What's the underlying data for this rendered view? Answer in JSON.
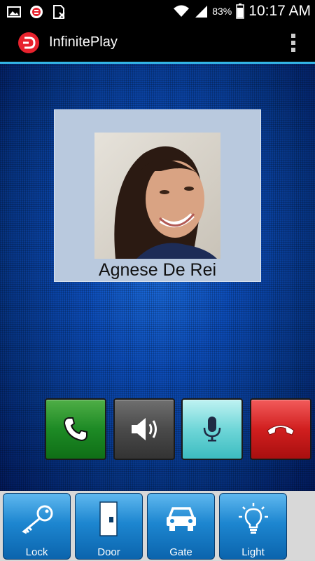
{
  "status_bar": {
    "battery_percent": "83%",
    "time": "10:17 AM",
    "icons": [
      "image-icon",
      "app-notification-icon",
      "sim-card-icon",
      "wifi-icon",
      "signal-icon",
      "battery-icon"
    ]
  },
  "app_bar": {
    "title": "InfinitePlay",
    "logo_icon": "infiniteplay-logo-icon",
    "menu_icon": "overflow-menu-icon"
  },
  "contact": {
    "name": "Agnese De Rei"
  },
  "call_controls": [
    {
      "icon": "phone-answer-icon",
      "color": "#1d8a25"
    },
    {
      "icon": "speaker-icon",
      "color": "#4a4a4a"
    },
    {
      "icon": "microphone-icon",
      "color": "#6fd6d8"
    },
    {
      "icon": "hang-up-icon",
      "color": "#d11f1f"
    }
  ],
  "bottom_actions": [
    {
      "label": "Lock",
      "icon": "key-icon"
    },
    {
      "label": "Door",
      "icon": "door-icon"
    },
    {
      "label": "Gate",
      "icon": "car-icon"
    },
    {
      "label": "Light",
      "icon": "light-bulb-icon"
    }
  ],
  "colors": {
    "accent_line": "#33b5e5",
    "nav_button": "#1d86d0",
    "logo": "#e8222d"
  }
}
